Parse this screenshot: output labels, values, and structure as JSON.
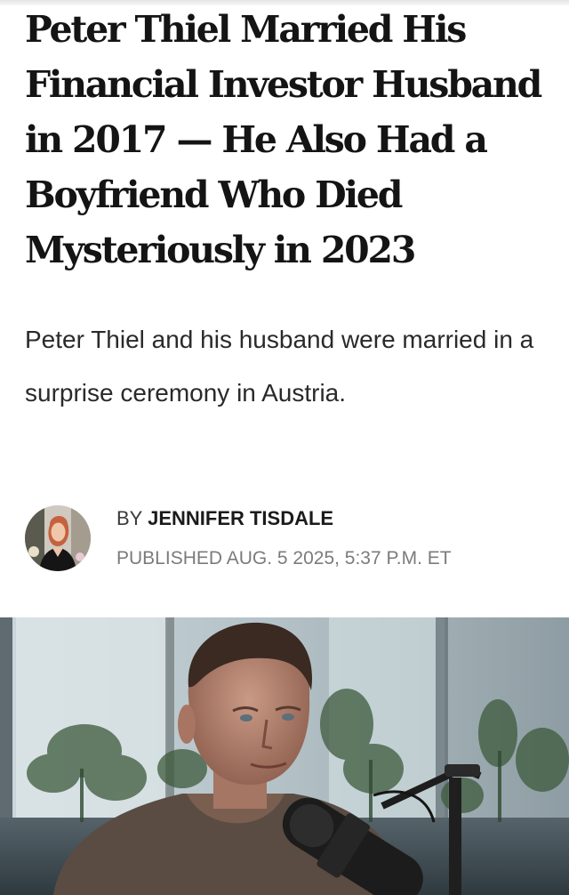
{
  "article": {
    "headline": "Peter Thiel Married His Financial Investor Husband in 2017 — He Also Had a Boyfriend Who Died Mysteriously in 2023",
    "dek": "Peter Thiel and his husband were married in a surprise ceremony in Austria."
  },
  "byline": {
    "prefix": "BY",
    "author": "JENNIFER TISDALE",
    "published": "PUBLISHED AUG. 5 2025, 5:37 P.M. ET"
  },
  "media": {
    "hero_image": "man-at-podcast-microphone-photo",
    "author_avatar": "author-portrait-photo"
  }
}
